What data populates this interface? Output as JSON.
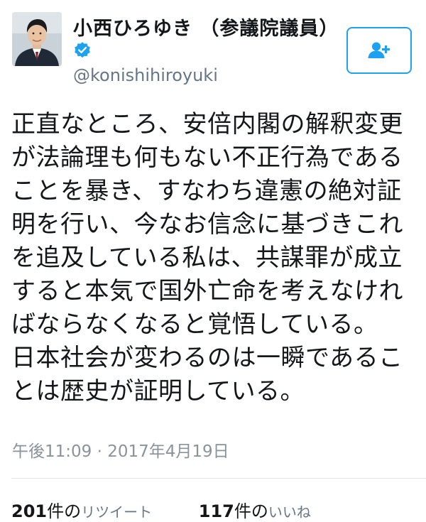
{
  "author": {
    "display_name": "小西ひろゆき （参議院議員）",
    "handle": "@konishihiroyuki",
    "verified": true
  },
  "follow_button": {
    "icon": "add-user-icon"
  },
  "tweet": {
    "text": "正直なところ、安倍内閣の解釈変更\nが法論理も何もない不正行為である\nことを暴き、すなわち違憲の絶対証\n明を行い、今なお信念に基づきこれ\nを追及している私は、共謀罪が成立\nすると本気で国外亡命を考えなけれ\nばならなくなると覚悟している。\n日本社会が変わるのは一瞬であるこ\nとは歴史が証明している。",
    "timestamp": "午後11:09 · 2017年4月19日"
  },
  "stats": {
    "retweets": {
      "count": "201",
      "unit": "件の",
      "label": "リツイート"
    },
    "likes": {
      "count": "117",
      "unit": "件の",
      "label": "いいね"
    }
  },
  "colors": {
    "accent": "#1da1f2",
    "text": "#14171a",
    "secondary": "#657786",
    "divider": "#e1e8ed"
  }
}
